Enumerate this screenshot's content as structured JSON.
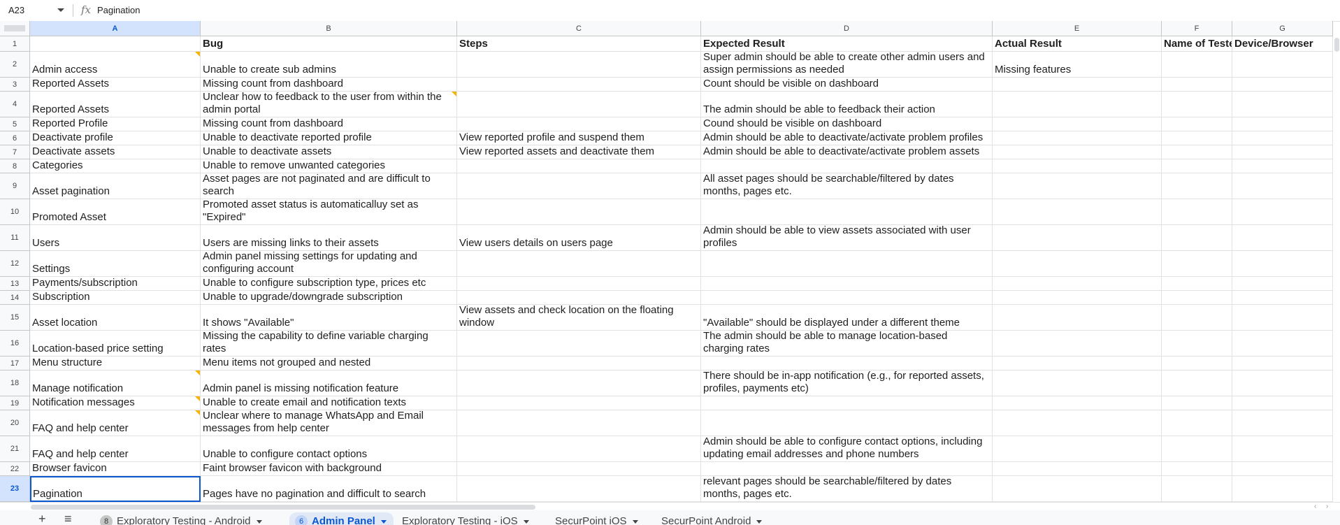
{
  "formula_bar": {
    "cell_ref": "A23",
    "fx_label": "fx",
    "content": "Pagination"
  },
  "columns": [
    "A",
    "B",
    "C",
    "D",
    "E",
    "F",
    "G"
  ],
  "selected_column": "A",
  "selected_row": "23",
  "header_row": [
    "",
    "Bug",
    "Steps",
    "Expected Result",
    "Actual Result",
    "Name of Teste",
    "Device/Browser"
  ],
  "rows": [
    {
      "num": "2",
      "cells": [
        "Admin access",
        "Unable to create sub admins",
        "",
        "Super admin should be able to create other admin users and assign permissions as needed",
        "Missing features",
        "",
        ""
      ]
    },
    {
      "num": "3",
      "cells": [
        "Reported Assets",
        "Missing count from dashboard",
        "",
        "Count should be visible on dashboard",
        "",
        "",
        ""
      ]
    },
    {
      "num": "4",
      "cells": [
        "Reported Assets",
        "Unclear how to feedback to the user from within the admin portal",
        "",
        "The admin should be able to feedback their action",
        "",
        "",
        ""
      ]
    },
    {
      "num": "5",
      "cells": [
        "Reported Profile",
        "Missing count from dashboard",
        "",
        "Cound should be visible on dashboard",
        "",
        "",
        ""
      ]
    },
    {
      "num": "6",
      "cells": [
        "Deactivate profile",
        "Unable to deactivate reported profile",
        "View reported profile and suspend them",
        "Admin should be able to deactivate/activate problem profiles",
        "",
        "",
        ""
      ]
    },
    {
      "num": "7",
      "cells": [
        "Deactivate assets",
        "Unable to deactivate assets",
        "View reported assets and deactivate them",
        "Admin should be able to deactivate/activate problem assets",
        "",
        "",
        ""
      ]
    },
    {
      "num": "8",
      "cells": [
        "Categories",
        "Unable to remove unwanted categories",
        "",
        "",
        "",
        "",
        ""
      ]
    },
    {
      "num": "9",
      "cells": [
        "Asset pagination",
        "Asset pages are not paginated and are difficult to search",
        "",
        "All asset pages should be searchable/filtered by dates months, pages etc.",
        "",
        "",
        ""
      ]
    },
    {
      "num": "10",
      "cells": [
        "Promoted Asset",
        "Promoted asset status is automaticalluy set as \"Expired\"",
        "",
        "",
        "",
        "",
        ""
      ]
    },
    {
      "num": "11",
      "cells": [
        "Users",
        "Users are missing links to their assets",
        "View users details on users page",
        "Admin should be able to view assets associated with user profiles",
        "",
        "",
        ""
      ]
    },
    {
      "num": "12",
      "cells": [
        "Settings",
        "Admin panel missing settings for updating and configuring account",
        "",
        "",
        "",
        "",
        ""
      ]
    },
    {
      "num": "13",
      "cells": [
        "Payments/subscription",
        "Unable to configure subscription type, prices etc",
        "",
        "",
        "",
        "",
        ""
      ]
    },
    {
      "num": "14",
      "cells": [
        "Subscription",
        "Unable to upgrade/downgrade subscription",
        "",
        "",
        "",
        "",
        ""
      ]
    },
    {
      "num": "15",
      "cells": [
        "Asset location",
        "It shows \"Available\"",
        "View assets and check location on the floating window",
        "\"Available\" should be displayed under a different theme",
        "",
        "",
        ""
      ]
    },
    {
      "num": "16",
      "cells": [
        "Location-based price setting",
        "Missing the capability to define variable charging rates",
        "",
        "The admin should be able to manage location-based charging rates",
        "",
        "",
        ""
      ]
    },
    {
      "num": "17",
      "cells": [
        "Menu structure",
        "Menu items not grouped and nested",
        "",
        "",
        "",
        "",
        ""
      ]
    },
    {
      "num": "18",
      "cells": [
        "Manage notification",
        "Admin panel is missing notification feature",
        "",
        "There should be in-app notification (e.g., for reported assets, profiles, payments etc)",
        "",
        "",
        ""
      ]
    },
    {
      "num": "19",
      "cells": [
        "Notification messages",
        "Unable to create email and notification texts",
        "",
        "",
        "",
        "",
        ""
      ]
    },
    {
      "num": "20",
      "cells": [
        "FAQ and help center",
        "Unclear where to manage WhatsApp and Email messages from help center",
        "",
        "",
        "",
        "",
        ""
      ]
    },
    {
      "num": "21",
      "cells": [
        "FAQ and help center",
        "Unable to configure contact options",
        "",
        "Admin should be able to configure contact options, including updating email addresses and phone numbers",
        "",
        "",
        ""
      ]
    },
    {
      "num": "22",
      "cells": [
        "Browser favicon",
        "Faint browser favicon with background",
        "",
        "",
        "",
        "",
        ""
      ]
    },
    {
      "num": "23",
      "cells": [
        "Pagination",
        "Pages have no pagination and difficult to search",
        "",
        "relevant pages should be searchable/filtered by dates months, pages etc.",
        "",
        "",
        ""
      ]
    }
  ],
  "sheet_tabs": [
    {
      "label": "Exploratory Testing - Android",
      "badge": "8",
      "active": false
    },
    {
      "label": "Admin Panel",
      "badge": "6",
      "active": true
    },
    {
      "label": "Exploratory Testing - iOS",
      "badge": "",
      "active": false
    },
    {
      "label": "SecurPoint iOS",
      "badge": "",
      "active": false
    },
    {
      "label": "SecurPoint Android",
      "badge": "",
      "active": false
    }
  ],
  "icons": {
    "add_sheet": "plus-icon",
    "all_sheets": "menu-icon",
    "note": "note-indicator",
    "fx": "function-icon"
  },
  "colors": {
    "accent": "#0b57d0",
    "selected_header": "#d3e3fd",
    "note": "#f4b400"
  }
}
